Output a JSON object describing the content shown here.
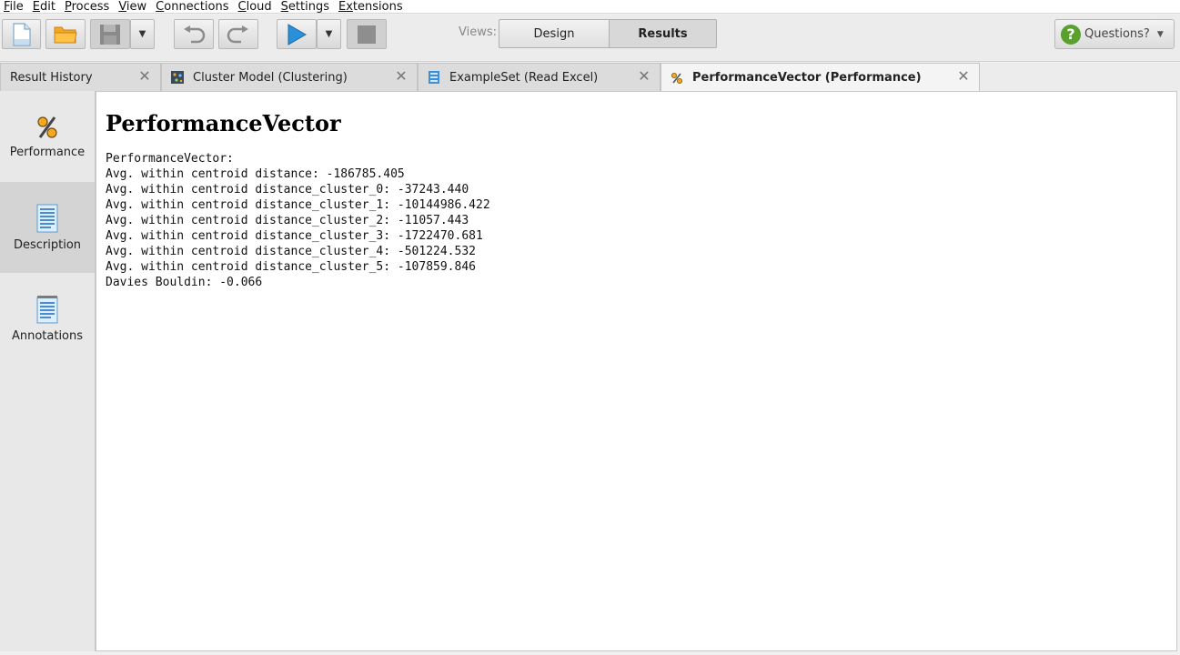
{
  "menu": [
    {
      "mnemonic": "F",
      "rest": "ile"
    },
    {
      "mnemonic": "E",
      "rest": "dit"
    },
    {
      "mnemonic": "P",
      "rest": "rocess"
    },
    {
      "mnemonic": "V",
      "rest": "iew"
    },
    {
      "mnemonic": "C",
      "rest": "onnections"
    },
    {
      "mnemonic": "C",
      "rest": "loud"
    },
    {
      "mnemonic": "S",
      "rest": "ettings"
    },
    {
      "mnemonic": "Ex",
      "rest": "tensions"
    }
  ],
  "toolbar": {
    "views_label": "Views:",
    "design_label": "Design",
    "results_label": "Results",
    "questions_label": "Questions?"
  },
  "tabs": [
    {
      "label": "Result History",
      "icon": "none"
    },
    {
      "label": "Cluster Model (Clustering)",
      "icon": "cluster-model-icon"
    },
    {
      "label": "ExampleSet (Read Excel)",
      "icon": "exampleset-icon"
    },
    {
      "label": "PerformanceVector (Performance)",
      "icon": "percent-icon"
    }
  ],
  "side": {
    "performance": "Performance",
    "description": "Description",
    "annotations": "Annotations"
  },
  "content": {
    "title": "PerformanceVector",
    "lines": [
      "PerformanceVector:",
      "Avg. within centroid distance: -186785.405",
      "Avg. within centroid distance_cluster_0: -37243.440",
      "Avg. within centroid distance_cluster_1: -10144986.422",
      "Avg. within centroid distance_cluster_2: -11057.443",
      "Avg. within centroid distance_cluster_3: -1722470.681",
      "Avg. within centroid distance_cluster_4: -501224.532",
      "Avg. within centroid distance_cluster_5: -107859.846",
      "Davies Bouldin: -0.066"
    ]
  },
  "colors": {
    "accent_blue": "#2b8fd9",
    "folder_orange": "#f5a623",
    "question_green": "#5aa02c"
  }
}
